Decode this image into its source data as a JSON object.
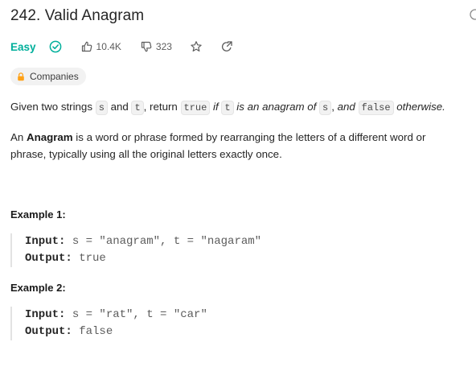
{
  "problem": {
    "title": "242. Valid Anagram",
    "difficulty": "Easy",
    "likes": "10.4K",
    "dislikes": "323",
    "companies_label": "Companies"
  },
  "description": {
    "p1": {
      "a": "Given two strings ",
      "code_s": "s",
      "b": " and ",
      "code_t": "t",
      "c": ", return ",
      "code_true": "true",
      "d": " ",
      "if": "if",
      "e": " ",
      "code_t2": "t",
      "f": " ",
      "is_an_anagram_of": "is an anagram of",
      "g": " ",
      "code_s2": "s",
      "h": ", ",
      "and": "and",
      "i": " ",
      "code_false": "false",
      "j": " ",
      "otherwise": "otherwise."
    },
    "p2": {
      "a": "An ",
      "bold": "Anagram",
      "b": " is a word or phrase formed by rearranging the letters of a different word or phrase, typically using all the original letters exactly once."
    }
  },
  "examples": [
    {
      "title": "Example 1:",
      "input_label": "Input:",
      "input_value": " s = \"anagram\", t = \"nagaram\"",
      "output_label": "Output:",
      "output_value": " true"
    },
    {
      "title": "Example 2:",
      "input_label": "Input:",
      "input_value": " s = \"rat\", t = \"car\"",
      "output_label": "Output:",
      "output_value": " false"
    }
  ],
  "colors": {
    "easy": "#00af9b",
    "text": "#262626",
    "muted": "#5c5c5c",
    "pill_bg": "#f2f2f2",
    "lock": "#ffa116"
  },
  "icons": {
    "solved": "check-circle-icon",
    "like": "thumbs-up-icon",
    "dislike": "thumbs-down-icon",
    "favorite": "star-icon",
    "share": "share-icon",
    "companies": "lock-icon",
    "edge": "clock-icon"
  }
}
